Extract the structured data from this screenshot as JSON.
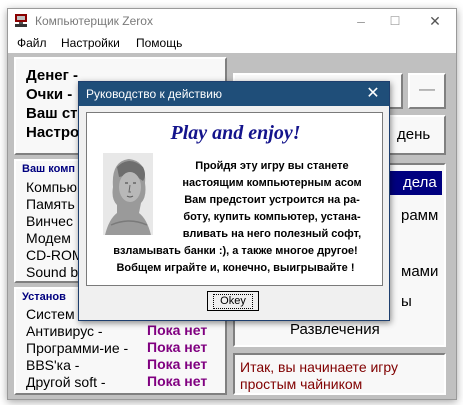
{
  "window": {
    "title": "Компьютерщик Zerox",
    "minimize": "–",
    "maximize": "☐",
    "close": "✕"
  },
  "menu": [
    "Файл",
    "Настройки",
    "Помощь"
  ],
  "status": [
    "Денег -",
    "Очки -",
    "Ваш ст",
    "Настро"
  ],
  "right_top": {
    "button_label": "день"
  },
  "computer_group": {
    "title": "Ваш комп",
    "items": [
      "Компью",
      "Память",
      "Винчес",
      "Модем",
      "CD-ROM",
      "Sound b"
    ]
  },
  "software_group": {
    "title": "Установ",
    "rows": [
      {
        "label": "Систем",
        "value": ""
      },
      {
        "label": "Антивирус -",
        "value": "Пока нет"
      },
      {
        "label": "Программи-ие -",
        "value": "Пока нет"
      },
      {
        "label": "BBS'ка -",
        "value": "Пока нет"
      },
      {
        "label": "Другой soft -",
        "value": "Пока нет"
      }
    ]
  },
  "actions": {
    "selected": "дела",
    "items": [
      "рамм",
      "мами",
      "ы",
      "Развлечения"
    ]
  },
  "message": [
    "Итак, вы начинаете игру",
    "простым чайником"
  ],
  "colors": {
    "dialog_title_bg": "#1f4e79",
    "heading": "#14148c",
    "value_text": "#800080",
    "selected_bg": "#000080",
    "message_text": "#800000"
  },
  "dialog": {
    "title": "Руководство к действию",
    "close": "✕",
    "heading": "Play and enjoy!",
    "lines": [
      "Пройдя эту игру вы станете",
      "настоящим компьютерным асом",
      "Вам предстоит устроится на ра-",
      "боту, купить компьютер, устана-",
      "вливать на него полезный софт,",
      "взламывать банки :), а также многое другое!",
      "Вобщем играйте и, конечно, выигрывайте !"
    ],
    "ok": "Okey",
    "image": "statue-bust-icon"
  }
}
